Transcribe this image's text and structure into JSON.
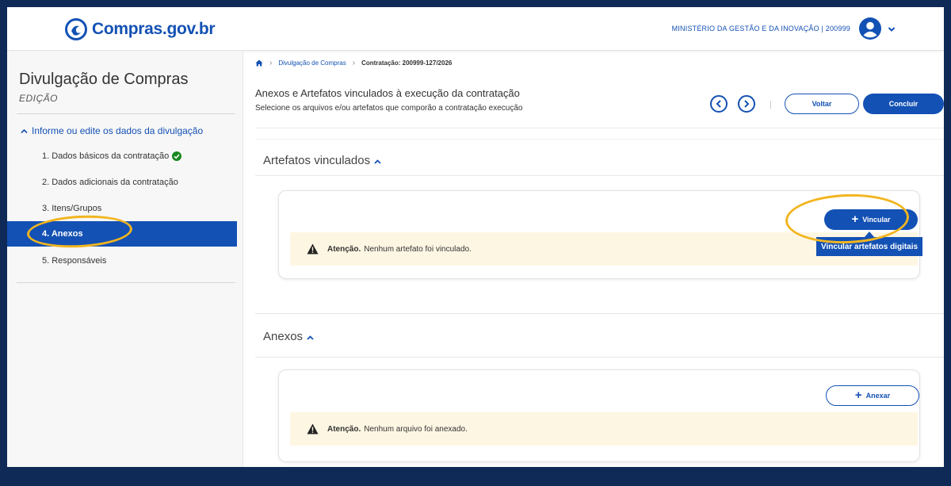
{
  "header": {
    "logo_text": "Compras.gov.br",
    "ministry_text": "MINISTÉRIO DA GESTÃO E DA INOVAÇÃO | 200999",
    "brand_color": "#1351b4"
  },
  "sidebar": {
    "title": "Divulgação de Compras",
    "subtitle": "EDIÇÃO",
    "group_label": "Informe ou edite os dados da divulgação",
    "items": [
      {
        "label": "1. Dados básicos da contratação",
        "completed": true
      },
      {
        "label": "2. Dados adicionais da contratação"
      },
      {
        "label": "3. Itens/Grupos"
      },
      {
        "label": "4. Anexos",
        "active": true
      },
      {
        "label": "5. Responsáveis"
      }
    ]
  },
  "breadcrumb": {
    "home_icon": "home-icon",
    "items": [
      "Divulgação de Compras",
      "Contratação: 200999-127/2026"
    ]
  },
  "page": {
    "title": "Anexos e Artefatos vinculados à execução da contratação",
    "subtitle": "Selecione os arquivos e/ou artefatos que comporão a contratação execução",
    "back_label": "Voltar",
    "finish_label": "Concluir"
  },
  "artefatos": {
    "title": "Artefatos vinculados",
    "button_label": "Vincular",
    "tooltip": "Vincular artefatos digitais",
    "alert_bold": "Atenção.",
    "alert_text": "Nenhum artefato foi vinculado."
  },
  "anexos": {
    "title": "Anexos",
    "button_label": "Anexar",
    "alert_bold": "Atenção.",
    "alert_text": "Nenhum arquivo foi anexado."
  },
  "colors": {
    "primary": "#1351b4",
    "alert_bg": "#fdf6e3",
    "highlight": "#f2b51f",
    "frame": "#0f2a57"
  }
}
